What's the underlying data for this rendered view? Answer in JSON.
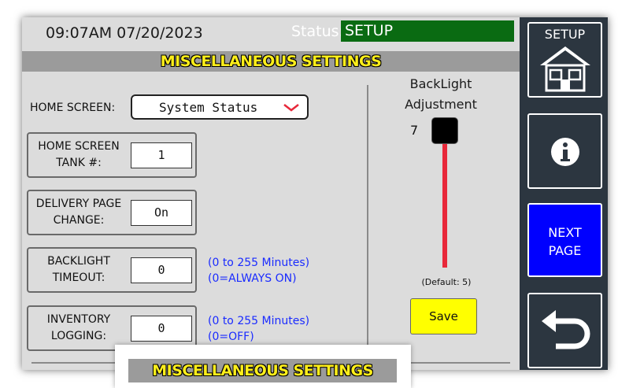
{
  "header": {
    "datetime": "09:07AM 07/20/2023",
    "status_label": "Status:",
    "status_value": "SETUP"
  },
  "page_title": "MISCELLANEOUS SETTINGS",
  "home_screen": {
    "label": "HOME SCREEN:",
    "value": "System Status"
  },
  "settings": {
    "home_screen_tank": {
      "label": "HOME SCREEN\nTANK #:",
      "value": "1"
    },
    "delivery_page_change": {
      "label": "DELIVERY PAGE\nCHANGE:",
      "value": "On"
    },
    "backlight_timeout": {
      "label": "BACKLIGHT\nTIMEOUT:",
      "value": "0",
      "hint": "(0 to 255 Minutes)\n(0=ALWAYS ON)"
    },
    "inventory_logging": {
      "label": "INVENTORY\nLOGGING:",
      "value": "0",
      "hint": "(0 to 255 Minutes)\n(0=OFF)"
    }
  },
  "backlight": {
    "title": "BackLight\nAdjustment",
    "value": "7",
    "default_text": "(Default: 5)",
    "save_label": "Save"
  },
  "sidebar": {
    "setup_label": "SETUP",
    "next_page_label": "NEXT\nPAGE"
  },
  "popup": {
    "title": "MISCELLANEOUS SETTINGS"
  },
  "colors": {
    "status_green": "#0a6b12",
    "title_yellow": "#ffef1a",
    "slider_red": "#e8283a",
    "save_yellow": "#ffff00",
    "next_blue": "#0000ff",
    "hint_blue": "#1a2bff"
  }
}
